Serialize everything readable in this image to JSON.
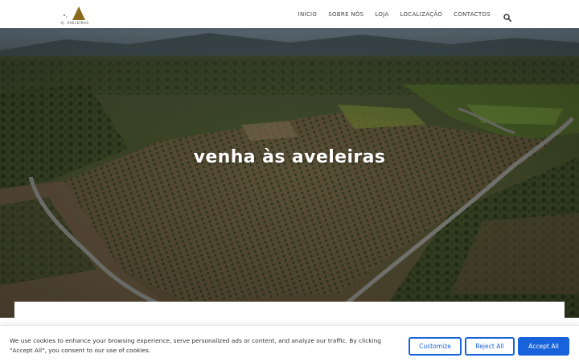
{
  "header": {
    "logo_text": "Q. AVELEIRAS",
    "nav": [
      "INÍCIO",
      "SOBRE NÓS",
      "LOJA",
      "LOCALIZAÇÃO",
      "CONTACTOS"
    ],
    "search_icon": "search-icon"
  },
  "hero": {
    "title": "venha às aveleiras"
  },
  "cookie": {
    "text": "We use cookies to enhance your browsing experience, serve personalized ads or content, and analyze our traffic. By clicking \"Accept All\", you consent to our use of cookies.",
    "customize_label": "Customize",
    "reject_label": "Reject All",
    "accept_label": "Accept All"
  },
  "colors": {
    "brand": "#8a6a1c",
    "button_blue": "#1863dc"
  }
}
